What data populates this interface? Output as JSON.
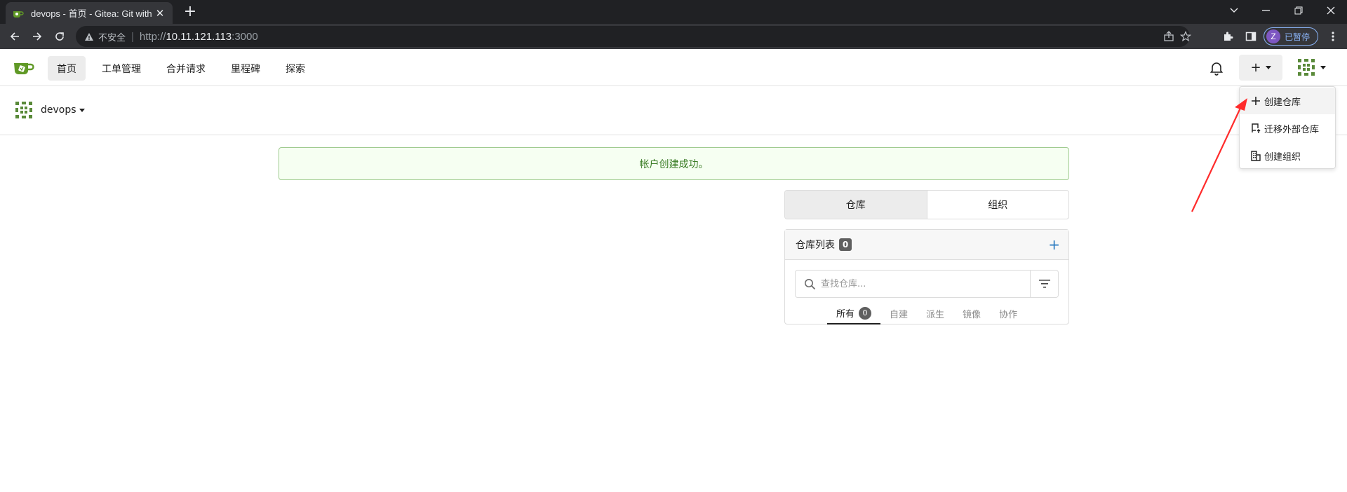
{
  "browser": {
    "tab_title": "devops - 首页 - Gitea: Git with a cup of tea",
    "new_tab": "+",
    "security_label": "不安全",
    "url_protocol": "http://",
    "url_host": "10.11.121.113",
    "url_port": ":3000",
    "profile_initial": "Z",
    "profile_label": "已暂停"
  },
  "header": {
    "nav": [
      {
        "label": "首页"
      },
      {
        "label": "工单管理"
      },
      {
        "label": "合并请求"
      },
      {
        "label": "里程碑"
      },
      {
        "label": "探索"
      }
    ],
    "create_plus": "+"
  },
  "dropdown": {
    "items": [
      {
        "label": "创建仓库",
        "icon": "plus-icon"
      },
      {
        "label": "迁移外部仓库",
        "icon": "repo-push-icon"
      },
      {
        "label": "创建组织",
        "icon": "organization-icon"
      }
    ]
  },
  "context": {
    "user_name": "devops"
  },
  "main": {
    "flash_message": "帐户创建成功。",
    "switch": [
      {
        "label": "仓库"
      },
      {
        "label": "组织"
      }
    ],
    "repo_panel": {
      "title": "仓库列表",
      "count": "0",
      "add": "+",
      "search_placeholder": "查找仓库...",
      "tabs": [
        {
          "label": "所有",
          "count": "0"
        },
        {
          "label": "自建"
        },
        {
          "label": "派生"
        },
        {
          "label": "镜像"
        },
        {
          "label": "协作"
        }
      ]
    }
  },
  "colors": {
    "accent_link": "#2a7ac0",
    "success_bg": "#f6fff2",
    "success_text": "#3a7c25",
    "gitea_green": "#609926",
    "annotation_red": "#ff2b2b"
  }
}
